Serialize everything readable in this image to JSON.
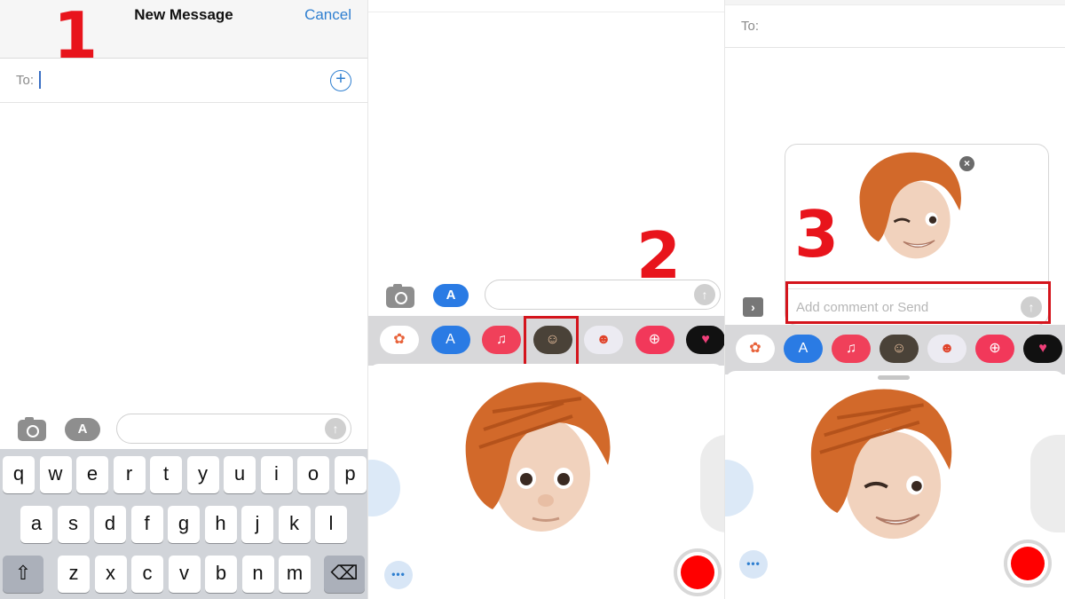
{
  "steps": [
    "1",
    "2",
    "3"
  ],
  "new_message": {
    "title": "New Message",
    "cancel": "Cancel",
    "to_label": "To:",
    "add_contact_icon": "plus-circle-icon"
  },
  "composer": {
    "camera_icon": "camera-icon",
    "apps_icon": "app-store-icon",
    "send_icon": "arrow-up-icon",
    "send_glyph": "↑",
    "apps_glyph": "A"
  },
  "keyboard": {
    "rows": [
      [
        "q",
        "w",
        "e",
        "r",
        "t",
        "y",
        "u",
        "i",
        "o",
        "p"
      ],
      [
        "a",
        "s",
        "d",
        "f",
        "g",
        "h",
        "j",
        "k",
        "l"
      ],
      [
        "z",
        "x",
        "c",
        "v",
        "b",
        "n",
        "m"
      ]
    ],
    "shift_glyph": "⇧",
    "delete_glyph": "⌫"
  },
  "app_drawer": [
    {
      "name": "photos",
      "glyph": "✿",
      "bg": "#ffffff",
      "fg": "#e8623a"
    },
    {
      "name": "app-store",
      "glyph": "A",
      "bg": "#2a7be4",
      "fg": "#ffffff"
    },
    {
      "name": "music",
      "glyph": "♫",
      "bg": "#f0405a",
      "fg": "#ffffff"
    },
    {
      "name": "memoji",
      "glyph": "☺",
      "bg": "#4a4238",
      "fg": "#f2c7a3"
    },
    {
      "name": "memoji-stickers",
      "glyph": "☻",
      "bg": "#ecebf2",
      "fg": "#e0432a"
    },
    {
      "name": "images-search",
      "glyph": "⊕",
      "bg": "#f2385a",
      "fg": "#ffffff"
    },
    {
      "name": "digital-touch",
      "glyph": "♥",
      "bg": "#111111",
      "fg": "#f0407a"
    }
  ],
  "memoji_panel": {
    "plus_glyph": "+",
    "more_glyph": "•••"
  },
  "preview": {
    "to_label": "To:",
    "comment_placeholder": "Add comment or Send",
    "close_glyph": "×",
    "expand_glyph": "›"
  },
  "colors": {
    "accent_blue": "#2f7fd0",
    "highlight_red": "#d4141c",
    "record_red": "#ff0000",
    "hair": "#d2692a",
    "skin": "#f1d2bd"
  }
}
